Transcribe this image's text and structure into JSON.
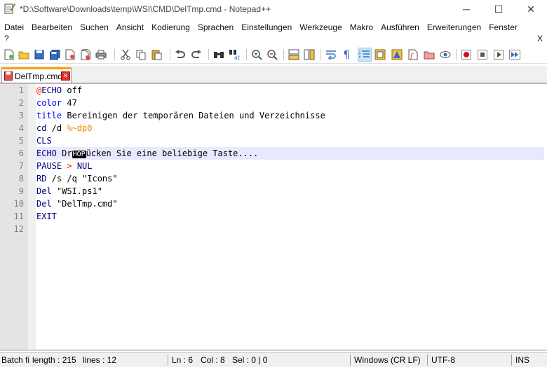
{
  "window": {
    "title": "*D:\\Software\\Downloads\\temp\\WSI\\CMD\\DelTmp.cmd - Notepad++",
    "controls": {
      "minimize": "─",
      "maximize": "☐",
      "close": "✕"
    }
  },
  "menu": {
    "items": [
      "Datei",
      "Bearbeiten",
      "Suchen",
      "Ansicht",
      "Kodierung",
      "Sprachen",
      "Einstellungen",
      "Werkzeuge",
      "Makro",
      "Ausführen",
      "Erweiterungen",
      "Fenster"
    ],
    "help": "?",
    "close_doc": "X"
  },
  "toolbar": {
    "icons": [
      "new-file-icon",
      "open-file-icon",
      "save-icon",
      "save-all-icon",
      "close-icon",
      "close-all-icon",
      "print-icon",
      "cut-icon",
      "copy-icon",
      "paste-icon",
      "undo-icon",
      "redo-icon",
      "find-icon",
      "replace-icon",
      "zoom-in-icon",
      "zoom-out-icon",
      "sync-vertical-icon",
      "sync-horizontal-icon",
      "word-wrap-icon",
      "show-all-chars-icon",
      "indent-guide-icon",
      "user-lang-icon",
      "doc-map-icon",
      "function-list-icon",
      "folder-workspace-icon",
      "monitoring-icon",
      "record-macro-icon",
      "stop-record-icon",
      "play-macro-icon",
      "run-macro-multiple-icon"
    ]
  },
  "tabs": [
    {
      "label": "DelTmp.cmd",
      "close": "✕"
    }
  ],
  "editor": {
    "line_numbers": [
      "1",
      "2",
      "3",
      "4",
      "5",
      "6",
      "7",
      "8",
      "9",
      "10",
      "11",
      "12"
    ],
    "current_line": 6,
    "lines": [
      [
        {
          "t": "@",
          "c": "at"
        },
        {
          "t": "ECHO",
          "c": "cmd"
        },
        {
          "t": " off",
          "c": ""
        }
      ],
      [
        {
          "t": "color",
          "c": "kw"
        },
        {
          "t": " 47",
          "c": ""
        }
      ],
      [
        {
          "t": "title",
          "c": "kw"
        },
        {
          "t": " Bereinigen der temporären Dateien und Verzeichnisse",
          "c": ""
        }
      ],
      [
        {
          "t": "cd",
          "c": "cmd"
        },
        {
          "t": " /d ",
          "c": ""
        },
        {
          "t": "%~dp0",
          "c": "var"
        }
      ],
      [
        {
          "t": "CLS",
          "c": "cmd"
        }
      ],
      [
        {
          "t": "ECHO",
          "c": "cmd"
        },
        {
          "t": " Dr",
          "c": ""
        },
        {
          "t": "HOP",
          "c": "hop"
        },
        {
          "t": "ücken Sie eine beliebige Taste....",
          "c": ""
        }
      ],
      [
        {
          "t": "PAUSE",
          "c": "cmd"
        },
        {
          "t": " ",
          "c": ""
        },
        {
          "t": ">",
          "c": "ex"
        },
        {
          "t": " NUL",
          "c": "cmd"
        }
      ],
      [
        {
          "t": "RD",
          "c": "cmd"
        },
        {
          "t": " /s /q \"Icons\"",
          "c": ""
        }
      ],
      [
        {
          "t": "Del",
          "c": "cmd"
        },
        {
          "t": " \"WSI.ps1\"",
          "c": ""
        }
      ],
      [
        {
          "t": "Del",
          "c": "cmd"
        },
        {
          "t": " \"DelTmp.cmd\"",
          "c": ""
        }
      ],
      [
        {
          "t": "EXIT",
          "c": "cmd"
        }
      ],
      []
    ]
  },
  "status": {
    "type": "Batch fi",
    "length": "length : 215",
    "lines": "lines : 12",
    "ln": "Ln : 6",
    "col": "Col : 8",
    "sel": "Sel : 0 | 0",
    "eol": "Windows (CR LF)",
    "encoding": "UTF-8",
    "mode": "INS"
  }
}
